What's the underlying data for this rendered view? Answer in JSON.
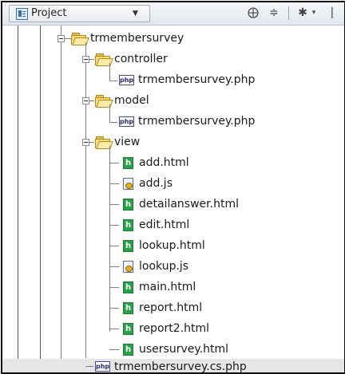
{
  "toolbar": {
    "project_label": "Project",
    "dropdown_icon": "chevron-down-icon",
    "locate_icon": "crosshair-icon",
    "collapse_icon": "collapse-all-icon",
    "settings_icon": "gear-icon"
  },
  "tree": {
    "root_folder": "trmembersurvey",
    "controller": {
      "folder": "controller",
      "files": [
        "trmembersurvey.php"
      ]
    },
    "model": {
      "folder": "model",
      "files": [
        "trmembersurvey.php"
      ]
    },
    "view": {
      "folder": "view",
      "files": [
        "add.html",
        "add.js",
        "detailanswer.html",
        "edit.html",
        "lookup.html",
        "lookup.js",
        "main.html",
        "report.html",
        "report2.html",
        "usersurvey.html"
      ]
    },
    "root_file": "trmembersurvey.cs.php",
    "php_badge": "php",
    "html_badge": "h"
  },
  "colors": {
    "folder": "#f7db7a",
    "html_icon": "#2aa04a",
    "selected_row": "#e6e6e6"
  }
}
